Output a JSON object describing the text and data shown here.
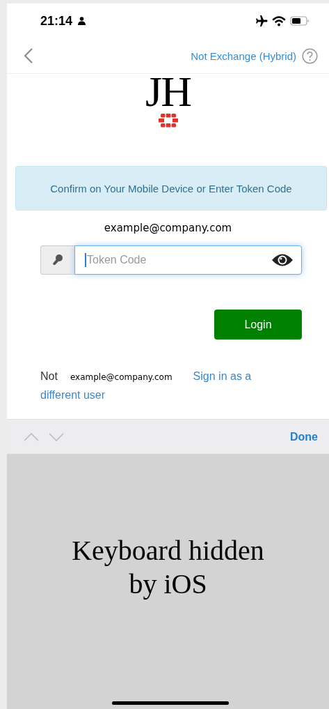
{
  "status_bar": {
    "time": "21:14"
  },
  "nav": {
    "title": "Not Exchange (Hybrid)"
  },
  "logo": {
    "text": "JH"
  },
  "alert": {
    "text": "Confirm on Your Mobile Device or Enter Token Code"
  },
  "user_email": "example@company.com",
  "token_field": {
    "placeholder": "Token Code",
    "focused": true
  },
  "login_button": {
    "label": "Login"
  },
  "switch_user": {
    "prefix": "Not",
    "email": "example@company.com",
    "link_lines": [
      "Sign in as a",
      "different user"
    ]
  },
  "accessory_bar": {
    "done": "Done"
  },
  "keyboard_note": "Keyboard hidden by iOS"
}
